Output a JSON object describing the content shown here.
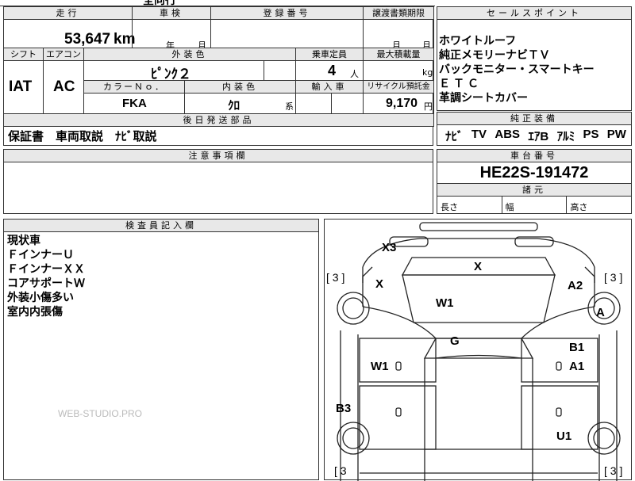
{
  "top_fragment": "全向行",
  "headers": {
    "mileage": "走行",
    "shaken": "車検",
    "registration": "登録番号",
    "transfer_deadline": "譲渡書類期限",
    "sales_point": "セールスポイント",
    "shift": "シフト",
    "aircon": "エアコン",
    "exterior_color": "外装色",
    "capacity": "乗車定員",
    "max_load": "最大積載量",
    "color_no": "カラーＮｏ．",
    "interior_color": "内装色",
    "import": "輸入車",
    "recycle": "リサイクル預託金",
    "later_parts": "後日発送部品",
    "equipment": "純正装備",
    "caution": "注意事項欄",
    "chassis": "車台番号",
    "dimensions": "諸元",
    "inspector": "検査員記入欄"
  },
  "values": {
    "mileage": "53,647",
    "mileage_unit": "km",
    "year_label": "年",
    "month_label": "月",
    "deadline_month": "月",
    "shift": "IAT",
    "aircon": "AC",
    "exterior_color": "ﾋﾟﾝｸ２",
    "capacity": "4",
    "capacity_unit": "人",
    "load_unit": "kg",
    "color_no": "FKA",
    "interior_color": "ｸﾛ",
    "interior_suffix": "系",
    "recycle": "9,170",
    "recycle_unit": "円",
    "later_parts": "保証書　車両取説　ﾅﾋﾞ取説",
    "chassis": "HE22S-191472",
    "length_label": "長さ",
    "width_label": "幅",
    "height_label": "高さ"
  },
  "sales_points": [
    "ホワイトルーフ",
    "純正メモリーナビＴＶ",
    "バックモニター・スマートキー",
    "ＥＴＣ",
    "革調シートカバー"
  ],
  "equipment": [
    "ﾅﾋﾞ",
    "TV",
    "ABS",
    "ｴｱB",
    "ｱﾙﾐ",
    "PS",
    "PW"
  ],
  "inspector_notes": [
    "現状車",
    "ＦインナーＵ",
    "ＦインナーＸＸ",
    "コアサポートＷ",
    "外装小傷多い",
    "室内内張傷"
  ],
  "watermark": "WEB-STUDIO.PRO",
  "diagram": {
    "tire_tl": "[ 3 ]",
    "tire_tr": "[ 3 ]",
    "tire_bl": "[ 3",
    "tire_br": "[ 3 ]",
    "marks": {
      "front_bumper": "X3",
      "hood": "X",
      "left_front_fender": "X",
      "windshield": "W1",
      "right_front_fender": "A2",
      "right_front_wheel": "A",
      "roof": "G",
      "left_window": "W1",
      "right_door_1": "B1",
      "right_door_2": "A1",
      "left_rear": "B3",
      "right_rear": "U1"
    }
  }
}
